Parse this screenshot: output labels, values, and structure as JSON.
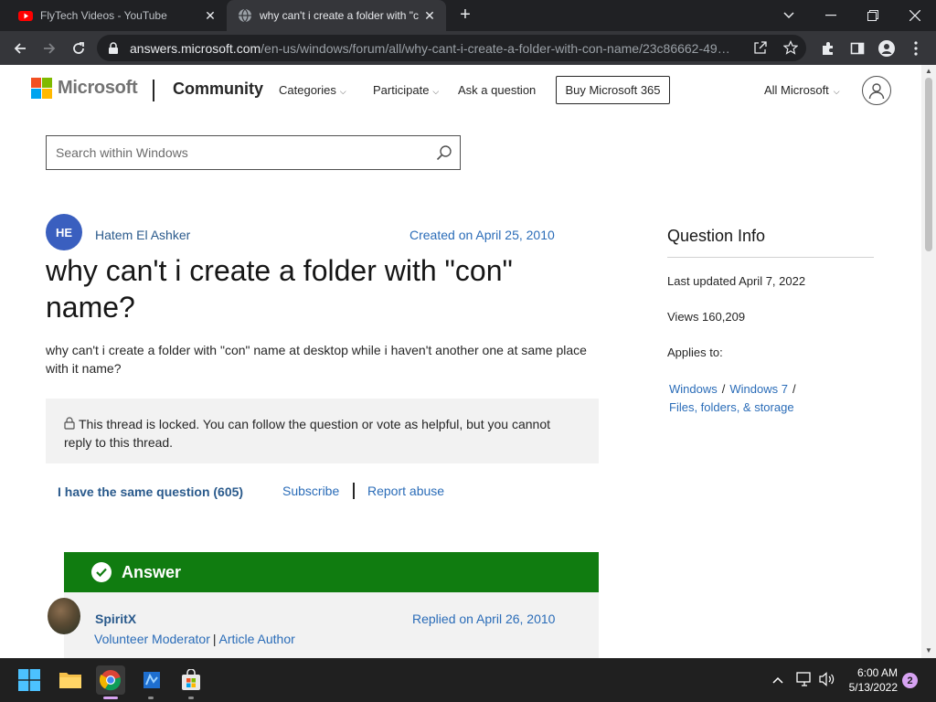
{
  "browser": {
    "tabs": [
      {
        "title": "FlyTech Videos - YouTube",
        "icon": "youtube-icon",
        "active": false
      },
      {
        "title": "why can't i create a folder with \"c",
        "icon": "globe-icon",
        "active": true
      }
    ],
    "url_host": "answers.microsoft.com",
    "url_path": "/en-us/windows/forum/all/why-cant-i-create-a-folder-with-con-name/23c86662-49…"
  },
  "header": {
    "brand": "Microsoft",
    "community": "Community",
    "nav": [
      "Categories",
      "Participate",
      "Ask a question"
    ],
    "buy_button": "Buy Microsoft 365",
    "all_microsoft": "All Microsoft"
  },
  "search": {
    "placeholder": "Search within Windows"
  },
  "question": {
    "author_initials": "HE",
    "author": "Hatem El Ashker",
    "created": "Created on April 25, 2010",
    "title": "why can't i create a folder with \"con\" name?",
    "body": "why can't i create a folder with \"con\" name at desktop while i haven't another one at same place with it name?",
    "locked_notice": "This thread is locked. You can follow the question or vote as helpful, but you cannot reply to this thread.",
    "same_question": "I have the same question (605)",
    "subscribe": "Subscribe",
    "report_abuse": "Report abuse"
  },
  "answer": {
    "label": "Answer",
    "replier": "SpiritX",
    "replied": "Replied on April 26, 2010",
    "role1": "Volunteer Moderator",
    "role2": "Article Author"
  },
  "question_info": {
    "title": "Question Info",
    "last_updated": "Last updated April 7, 2022",
    "views": "Views 160,209",
    "applies_to": "Applies to:",
    "links": [
      "Windows",
      "Windows 7",
      "Files, folders, & storage"
    ]
  },
  "taskbar": {
    "time": "6:00 AM",
    "date": "5/13/2022",
    "notifications": "2"
  },
  "colors": {
    "answer_green": "#107c10",
    "link_blue": "#2a6cb8"
  }
}
